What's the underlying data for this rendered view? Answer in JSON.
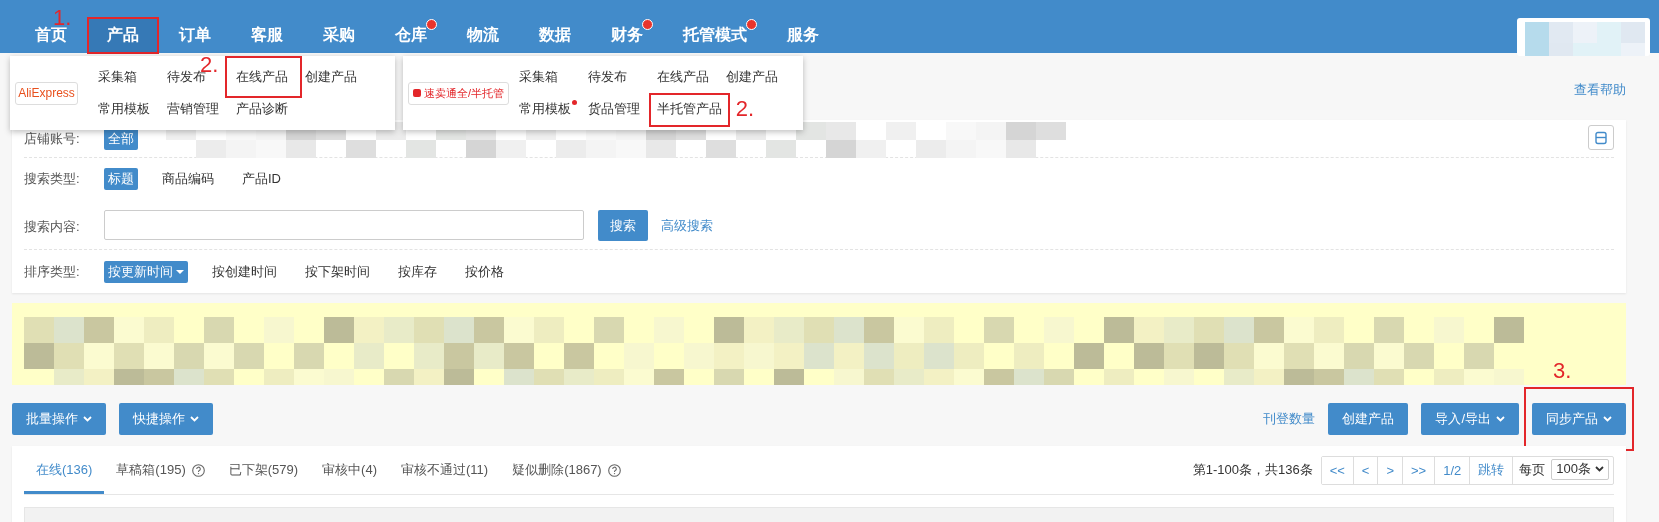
{
  "nav": {
    "items": [
      {
        "label": "首页",
        "selected": false,
        "dot": false
      },
      {
        "label": "产品",
        "selected": true,
        "dot": false,
        "highlighted": true,
        "callout": "1."
      },
      {
        "label": "订单",
        "selected": false,
        "dot": false
      },
      {
        "label": "客服",
        "selected": false,
        "dot": false
      },
      {
        "label": "采购",
        "selected": false,
        "dot": false
      },
      {
        "label": "仓库",
        "selected": false,
        "dot": true
      },
      {
        "label": "物流",
        "selected": false,
        "dot": false
      },
      {
        "label": "数据",
        "selected": false,
        "dot": false
      },
      {
        "label": "财务",
        "selected": false,
        "dot": true
      },
      {
        "label": "托管模式",
        "selected": false,
        "dot": true
      },
      {
        "label": "服务",
        "selected": false,
        "dot": false
      }
    ]
  },
  "menus": [
    {
      "logo": "AliExpress",
      "kind": "wordmark",
      "rows": [
        [
          {
            "label": "采集箱",
            "dot": false,
            "highlighted": false
          },
          {
            "label": "待发布",
            "dot": false,
            "highlighted": false
          },
          {
            "label": "在线产品",
            "dot": false,
            "highlighted": true,
            "callout": "2."
          },
          {
            "label": "创建产品",
            "dot": false,
            "highlighted": false
          }
        ],
        [
          {
            "label": "常用模板",
            "dot": false,
            "highlighted": false
          },
          {
            "label": "营销管理",
            "dot": false,
            "highlighted": false
          },
          {
            "label": "产品诊断",
            "dot": false,
            "highlighted": false
          }
        ]
      ]
    },
    {
      "logo": "速卖通全/半托管",
      "kind": "badge",
      "rows": [
        [
          {
            "label": "采集箱",
            "dot": false,
            "highlighted": false
          },
          {
            "label": "待发布",
            "dot": false,
            "highlighted": false
          },
          {
            "label": "在线产品",
            "dot": false,
            "highlighted": false
          },
          {
            "label": "创建产品",
            "dot": false,
            "highlighted": false
          }
        ],
        [
          {
            "label": "常用模板",
            "dot": true,
            "highlighted": false
          },
          {
            "label": "货品管理",
            "dot": false,
            "highlighted": false
          },
          {
            "label": "半托管产品",
            "dot": false,
            "highlighted": true,
            "callout": "2."
          }
        ]
      ]
    }
  ],
  "help_link": "查看帮助",
  "filters": [
    {
      "kind": "accounts",
      "label": "店铺账号:",
      "options": [
        {
          "label": "全部",
          "selected": true
        }
      ]
    },
    {
      "kind": "options",
      "label": "搜索类型:",
      "options": [
        {
          "label": "标题",
          "selected": true
        },
        {
          "label": "商品编码",
          "selected": false
        },
        {
          "label": "产品ID",
          "selected": false
        }
      ]
    },
    {
      "kind": "search",
      "label": "搜索内容:",
      "button": "搜索",
      "link": "高级搜索"
    },
    {
      "kind": "options",
      "label": "排序类型:",
      "options": [
        {
          "label": "按更新时间",
          "selected": true,
          "caret": true
        },
        {
          "label": "按创建时间",
          "selected": false,
          "caret": false
        },
        {
          "label": "按下架时间",
          "selected": false,
          "caret": false
        },
        {
          "label": "按库存",
          "selected": false,
          "caret": false
        },
        {
          "label": "按价格",
          "selected": false,
          "caret": false
        }
      ]
    }
  ],
  "toolbar": {
    "left": [
      {
        "label": "批量操作",
        "caret": true
      },
      {
        "label": "快捷操作",
        "caret": true
      }
    ],
    "link": "刊登数量",
    "right": [
      {
        "label": "创建产品",
        "caret": false,
        "highlighted": false
      },
      {
        "label": "导入/导出",
        "caret": true,
        "highlighted": false
      },
      {
        "label": "同步产品",
        "caret": true,
        "highlighted": true,
        "callout": "3."
      }
    ]
  },
  "tabs": [
    {
      "label": "在线(136)",
      "selected": true,
      "help": false
    },
    {
      "label": "草稿箱(195)",
      "selected": false,
      "help": true
    },
    {
      "label": "已下架(579)",
      "selected": false,
      "help": false
    },
    {
      "label": "审核中(4)",
      "selected": false,
      "help": false
    },
    {
      "label": "审核不通过(11)",
      "selected": false,
      "help": false
    },
    {
      "label": "疑似删除(1867)",
      "selected": false,
      "help": true
    }
  ],
  "pagination": {
    "summary": "第1-100条，共136条",
    "buttons": [
      "<<",
      "<",
      ">",
      ">>",
      "1/2",
      "跳转"
    ],
    "per_page_label": "每页",
    "per_page": "100条"
  }
}
